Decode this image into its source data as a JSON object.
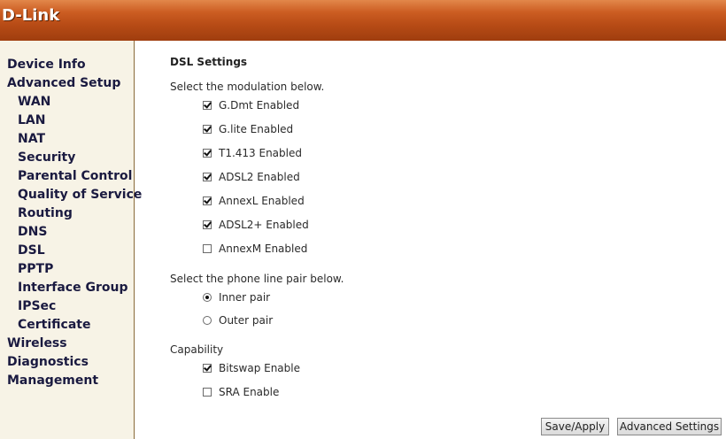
{
  "header": {
    "logo_text": "D-Link"
  },
  "sidebar": {
    "items": [
      {
        "label": "Device Info",
        "sub": false
      },
      {
        "label": "Advanced Setup",
        "sub": false
      },
      {
        "label": "WAN",
        "sub": true
      },
      {
        "label": "LAN",
        "sub": true
      },
      {
        "label": "NAT",
        "sub": true
      },
      {
        "label": "Security",
        "sub": true
      },
      {
        "label": "Parental Control",
        "sub": true
      },
      {
        "label": "Quality of Service",
        "sub": true
      },
      {
        "label": "Routing",
        "sub": true
      },
      {
        "label": "DNS",
        "sub": true
      },
      {
        "label": "DSL",
        "sub": true
      },
      {
        "label": "PPTP",
        "sub": true
      },
      {
        "label": "Interface Group",
        "sub": true
      },
      {
        "label": "IPSec",
        "sub": true
      },
      {
        "label": "Certificate",
        "sub": true
      },
      {
        "label": "Wireless",
        "sub": false
      },
      {
        "label": "Diagnostics",
        "sub": false
      },
      {
        "label": "Management",
        "sub": false
      }
    ]
  },
  "main": {
    "title": "DSL Settings",
    "modulation_prompt": "Select the modulation below.",
    "modulations": [
      {
        "label": "G.Dmt Enabled",
        "checked": true
      },
      {
        "label": "G.lite Enabled",
        "checked": true
      },
      {
        "label": "T1.413 Enabled",
        "checked": true
      },
      {
        "label": "ADSL2 Enabled",
        "checked": true
      },
      {
        "label": "AnnexL Enabled",
        "checked": true
      },
      {
        "label": "ADSL2+ Enabled",
        "checked": true
      },
      {
        "label": "AnnexM Enabled",
        "checked": false
      }
    ],
    "phone_prompt": "Select the phone line pair below.",
    "phone_pairs": [
      {
        "label": "Inner pair",
        "selected": true
      },
      {
        "label": "Outer pair",
        "selected": false
      }
    ],
    "capability_label": "Capability",
    "capabilities": [
      {
        "label": "Bitswap Enable",
        "checked": true
      },
      {
        "label": "SRA Enable",
        "checked": false
      }
    ]
  },
  "buttons": {
    "save_apply": "Save/Apply",
    "advanced_settings": "Advanced Settings"
  }
}
